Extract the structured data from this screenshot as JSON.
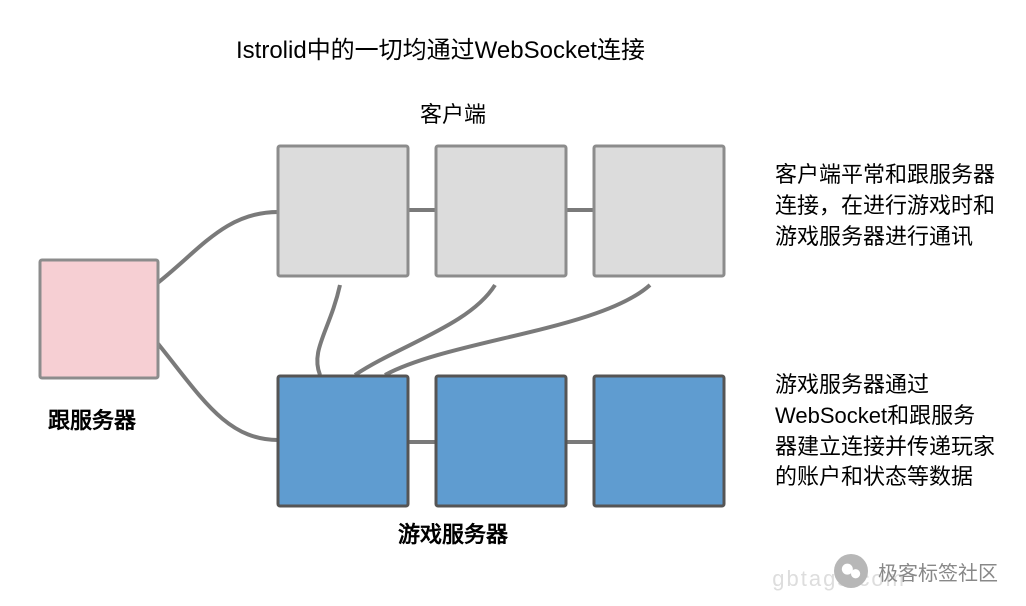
{
  "title": "Istrolid中的一切均通过WebSocket连接",
  "labels": {
    "client": "客户端",
    "root_server": "跟服务器",
    "game_server": "游戏服务器"
  },
  "descriptions": {
    "client": "客户端平常和跟服务器连接，在进行游戏时和游戏服务器进行通讯",
    "game_server": "游戏服务器通过WebSocket和跟服务器建立连接并传递玩家的账户和状态等数据"
  },
  "nodes": {
    "root": {
      "fill": "#f6cfd3",
      "stroke": "#8c8c8c"
    },
    "clients": {
      "count": 3,
      "fill": "#dcdcdc",
      "stroke": "#8c8c8c"
    },
    "game_servers": {
      "count": 3,
      "fill": "#5f9cd0",
      "stroke": "#555555"
    }
  },
  "watermark": {
    "faint": "gbtags.com",
    "channel": "极客标签社区"
  }
}
